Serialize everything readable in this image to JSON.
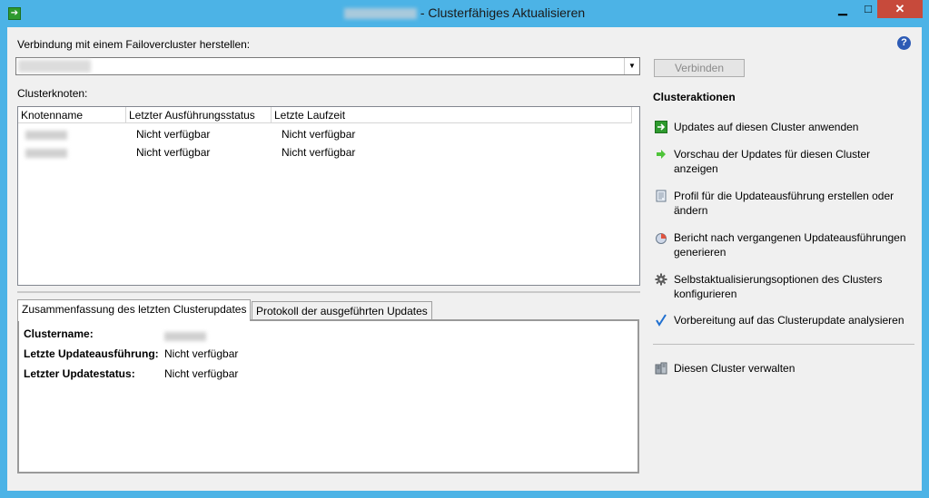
{
  "window": {
    "title": "- Clusterfähiges Aktualisieren",
    "min": "▁",
    "max": "□",
    "close": "✕"
  },
  "connection": {
    "label": "Verbindung mit einem Failovercluster herstellen:",
    "combo_arrow": "▼",
    "connect_button": "Verbinden"
  },
  "help": "?",
  "nodes": {
    "label": "Clusterknoten:",
    "columns": [
      "Knotenname",
      "Letzter Ausführungsstatus",
      "Letzte Laufzeit"
    ],
    "rows": [
      {
        "status": "Nicht verfügbar",
        "runtime": "Nicht verfügbar"
      },
      {
        "status": "Nicht verfügbar",
        "runtime": "Nicht verfügbar"
      }
    ]
  },
  "tabs": [
    {
      "label": "Zusammenfassung des letzten Clusterupdates",
      "active": true
    },
    {
      "label": "Protokoll der ausgeführten Updates",
      "active": false
    }
  ],
  "summary": {
    "cluster_name_label": "Clustername:",
    "last_run_label": "Letzte Updateausführung:",
    "last_run_value": "Nicht verfügbar",
    "last_status_label": "Letzter Updatestatus:",
    "last_status_value": "Nicht verfügbar"
  },
  "actions": {
    "heading": "Clusteraktionen",
    "items": [
      {
        "icon": "apply-updates-icon",
        "label": "Updates auf diesen Cluster anwenden"
      },
      {
        "icon": "preview-arrow-icon",
        "label": "Vorschau der Updates für diesen Cluster anzeigen"
      },
      {
        "icon": "profile-document-icon",
        "label": "Profil für die Updateausführung erstellen oder ändern"
      },
      {
        "icon": "report-chart-icon",
        "label": "Bericht nach vergangenen Updateausführungen generieren"
      },
      {
        "icon": "gear-icon",
        "label": "Selbstaktualisierungsoptionen des Clusters konfigurieren"
      },
      {
        "icon": "checkmark-icon",
        "label": "Vorbereitung auf das Clusterupdate analysieren"
      }
    ],
    "manage": {
      "icon": "server-icon",
      "label": "Diesen Cluster verwalten"
    }
  },
  "colors": {
    "titlebar": "#4cb3e6",
    "close_button": "#c74a3b",
    "accent_green": "#2e9a2e",
    "check_blue": "#1f6fd0"
  }
}
